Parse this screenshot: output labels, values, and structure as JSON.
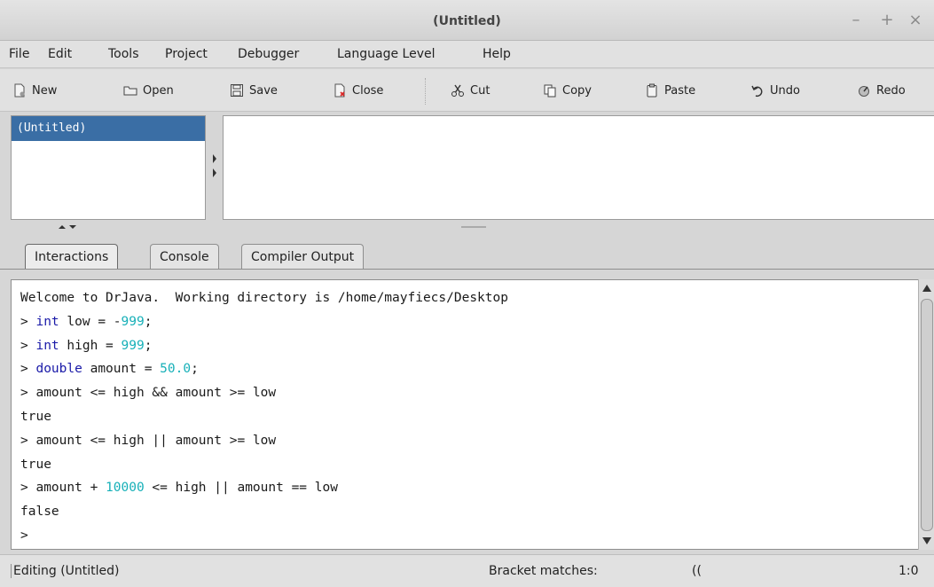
{
  "window": {
    "title": "(Untitled)",
    "controls": [
      "–",
      "+",
      "×"
    ]
  },
  "menu": [
    "File",
    "Edit",
    "Tools",
    "Project",
    "Debugger",
    "Language Level",
    "Help"
  ],
  "toolbar": {
    "new": "New",
    "open": "Open",
    "save": "Save",
    "close": "Close",
    "cut": "Cut",
    "copy": "Copy",
    "paste": "Paste",
    "undo": "Undo",
    "redo": "Redo"
  },
  "documents": [
    "(Untitled)"
  ],
  "tabs": [
    "Interactions",
    "Console",
    "Compiler Output"
  ],
  "interactions": {
    "welcome": "Welcome to DrJava.  Working directory is /home/mayfiecs/Desktop",
    "prompt": ">",
    "line1": {
      "kw": "int",
      "rest": "low = -",
      "num": "999",
      "end": ";"
    },
    "line2": {
      "kw": "int",
      "rest": "high = ",
      "num": "999",
      "end": ";"
    },
    "line3": {
      "kw": "double",
      "rest": "amount = ",
      "num": "50.0",
      "end": ";"
    },
    "line4": "amount <= high && amount >= low",
    "out4": "true",
    "line5": "amount <= high || amount >= low",
    "out5": "true",
    "line6": {
      "pre": "amount + ",
      "num": "10000",
      "rest": " <= high || amount == low"
    },
    "out6": "false"
  },
  "status": {
    "editing": "Editing (Untitled)",
    "bracket_label": "Bracket matches:",
    "bracket_value": "((",
    "position": "1:0"
  },
  "colors": {
    "keyword": "#1a1aa8",
    "number": "#17b0b8",
    "selection": "#3a6ea5"
  }
}
